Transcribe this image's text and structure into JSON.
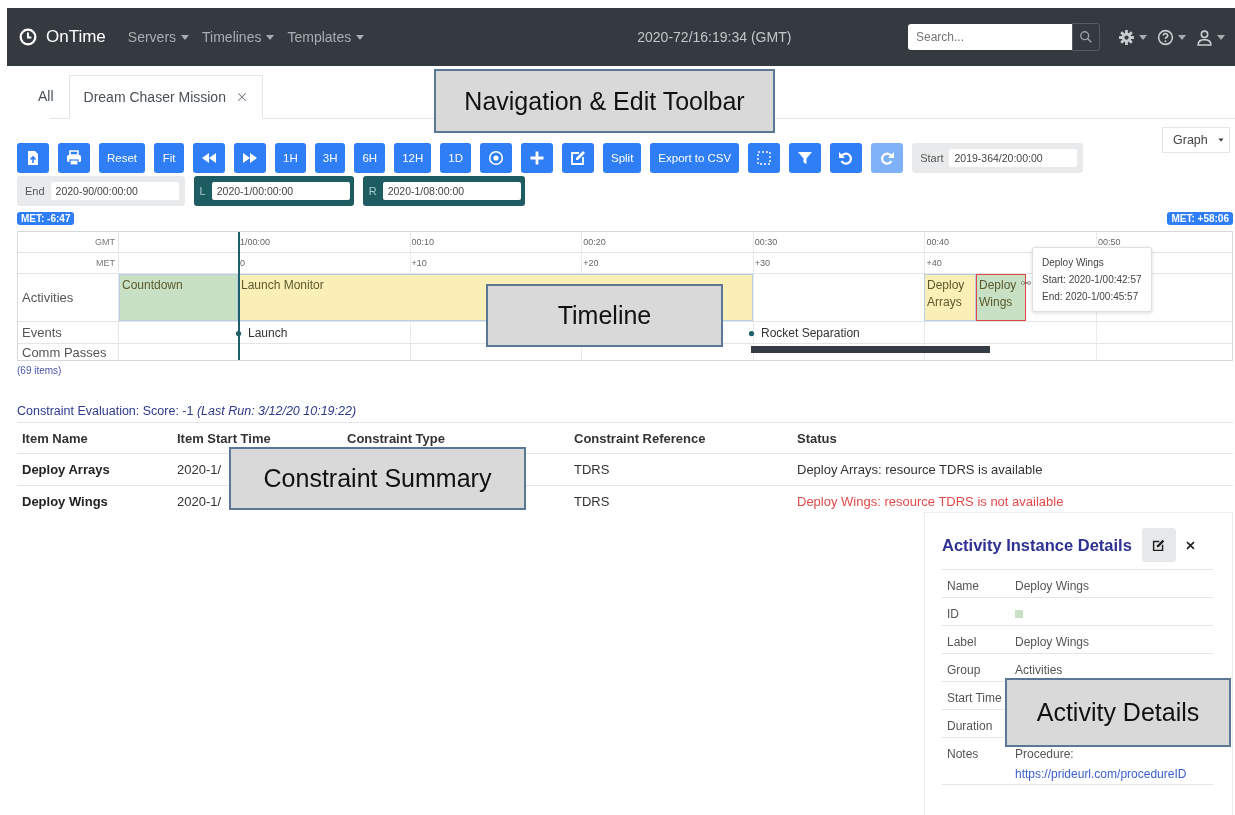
{
  "navbar": {
    "brand": "OnTime",
    "menus": [
      {
        "label": "Servers"
      },
      {
        "label": "Timelines"
      },
      {
        "label": "Templates"
      }
    ],
    "clock": "2020-72/16:19:34 (GMT)",
    "search": {
      "placeholder": "Search..."
    }
  },
  "tabs": [
    {
      "label": "All",
      "selected": false,
      "closable": false
    },
    {
      "label": "Dream Chaser Mission",
      "selected": true,
      "closable": true
    }
  ],
  "view_select": {
    "value": "Graph"
  },
  "toolbar": {
    "buttons": [
      {
        "kind": "icon",
        "disabled": false
      },
      {
        "kind": "icon",
        "disabled": false
      },
      {
        "kind": "text",
        "label": "Reset",
        "disabled": false
      },
      {
        "kind": "text",
        "label": "Fit",
        "disabled": false
      },
      {
        "kind": "icon",
        "disabled": false
      },
      {
        "kind": "icon",
        "disabled": false
      },
      {
        "kind": "text",
        "label": "1H",
        "disabled": false
      },
      {
        "kind": "text",
        "label": "3H",
        "disabled": false
      },
      {
        "kind": "text",
        "label": "6H",
        "disabled": false
      },
      {
        "kind": "text",
        "label": "12H",
        "disabled": false
      },
      {
        "kind": "text",
        "label": "1D",
        "disabled": false
      },
      {
        "kind": "icon",
        "disabled": false
      },
      {
        "kind": "icon",
        "disabled": false
      },
      {
        "kind": "icon",
        "disabled": false
      },
      {
        "kind": "text",
        "label": "Split",
        "disabled": false
      },
      {
        "kind": "text",
        "label": "Export to CSV",
        "disabled": false
      },
      {
        "kind": "icon",
        "disabled": false
      },
      {
        "kind": "icon",
        "disabled": false
      },
      {
        "kind": "icon",
        "disabled": false
      },
      {
        "kind": "icon",
        "disabled": true
      }
    ],
    "range_fields": [
      {
        "kind": "plain",
        "label": "Start",
        "value": "2019-364/20:00:00"
      },
      {
        "kind": "plain",
        "label": "End",
        "value": "2020-90/00:00:00"
      },
      {
        "kind": "window",
        "label": "L",
        "value": "2020-1/00:00:00"
      },
      {
        "kind": "window",
        "label": "R",
        "value": "2020-1/08:00:00"
      }
    ]
  },
  "timeline": {
    "met_start": "MET: -6:47",
    "met_end": "MET: +58:06",
    "header_rows": [
      {
        "label": "GMT",
        "ticks": [
          "1/00:00",
          "00:10",
          "00:20",
          "00:30",
          "00:40",
          "00:50"
        ]
      },
      {
        "label": "MET",
        "ticks": [
          "0",
          "+10",
          "+20",
          "+30",
          "+40"
        ]
      }
    ],
    "groups": [
      {
        "label": "Activities",
        "kind": "activities"
      },
      {
        "label": "Events",
        "kind": "events"
      },
      {
        "label": "Comm Passes",
        "kind": "passes"
      }
    ],
    "activities": [
      {
        "label": "Countdown",
        "color": "#c8e0c4",
        "selected": false
      },
      {
        "label": "Launch Monitor",
        "color": "#fbefb8",
        "selected": false
      },
      {
        "label": "Deploy Arrays",
        "color": "#fbefb8",
        "selected": false
      },
      {
        "label": "Deploy Wings",
        "color": "#c8e0c4",
        "selected": true
      }
    ],
    "events": [
      {
        "label": "Launch"
      },
      {
        "label": "Rocket Separation"
      }
    ],
    "comm_passes": [
      {
        "kind": "pass"
      }
    ],
    "tooltip": {
      "title": "Deploy Wings",
      "lines": [
        "Start: 2020-1/00:42:57",
        "End: 2020-1/00:45:57"
      ]
    },
    "item_count": "(69 items)"
  },
  "constraints": {
    "summary": "Constraint Evaluation: Score: -1 *(Last Run: 3/12/20 10:19:22)*",
    "columns": [
      "Item Name",
      "Item Start Time",
      "Constraint Type",
      "Constraint Reference",
      "Status"
    ],
    "rows": [
      {
        "item_name": "Deploy Arrays",
        "item_start_time": "2020-1/",
        "constraint_reference": "TDRS",
        "status": "Deploy Arrays: resource TDRS is available",
        "available": true
      },
      {
        "item_name": "Deploy Wings",
        "item_start_time": "2020-1/",
        "constraint_reference": "TDRS",
        "status": "Deploy Wings: resource TDRS is not available",
        "available": false
      }
    ]
  },
  "details": {
    "title": "Activity Instance Details",
    "fields": [
      {
        "label": "Name",
        "kind": "text",
        "value": "Deploy Wings"
      },
      {
        "label": "ID",
        "kind": "swatch"
      },
      {
        "label": "Label",
        "kind": "text",
        "value": "Deploy Wings"
      },
      {
        "label": "Group",
        "kind": "text",
        "value": "Activities"
      },
      {
        "label": "Start Time",
        "kind": "hidden"
      },
      {
        "label": "Duration",
        "kind": "hidden"
      },
      {
        "label": "Notes",
        "kind": "note",
        "value": "Procedure:",
        "link": "https://prideurl.com/procedureID"
      }
    ]
  },
  "callouts": [
    {
      "label": "Navigation & Edit Toolbar"
    },
    {
      "label": "Timeline"
    },
    {
      "label": "Constraint Summary"
    },
    {
      "label": "Activity Details"
    }
  ]
}
